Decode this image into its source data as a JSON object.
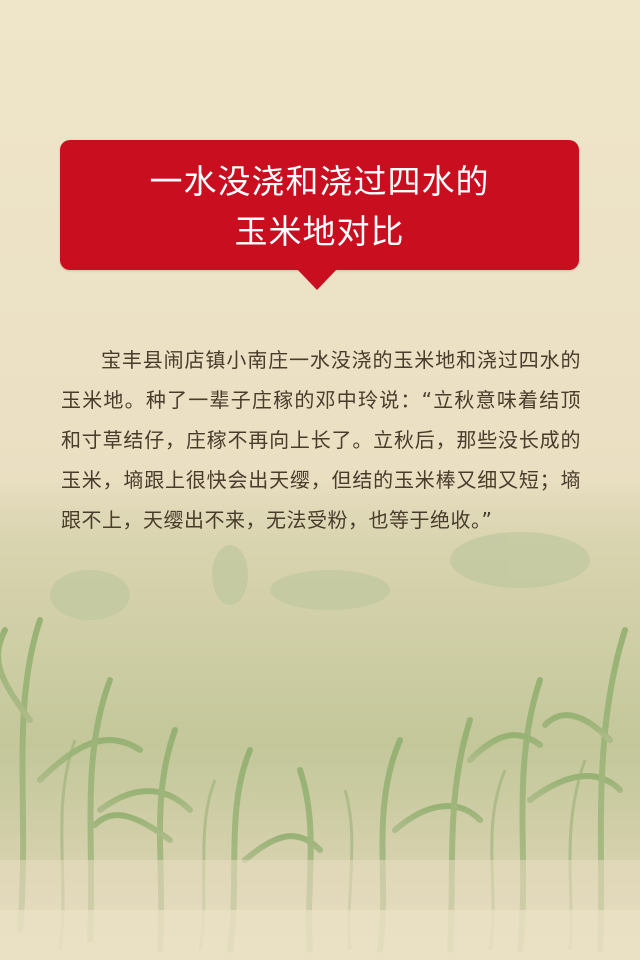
{
  "title": {
    "line1": "一水没浇和浇过四水的",
    "line2": "玉米地对比"
  },
  "article": {
    "paragraph": "宝丰县闹店镇小南庄一水没浇的玉米地和浇过四水的玉米地。种了一辈子庄稼的邓中玲说：“立秋意味着结顶和寸草结仔，庄稼不再向上长了。立秋后，那些没长成的玉米，墒跟上很快会出天缨，但结的玉米棒又细又短；墒跟不上，天缨出不来，无法受粉，也等于绝收。”"
  },
  "colors": {
    "banner": "#c90f1f",
    "background": "#ece2c6",
    "text": "#4a3c2c"
  }
}
